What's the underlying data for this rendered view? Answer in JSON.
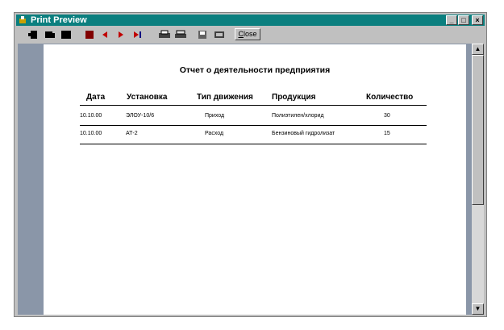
{
  "window": {
    "title": "Print Preview"
  },
  "toolbar": {
    "close_label": "Close",
    "close_access_key": "C",
    "close_rest": "lose"
  },
  "report": {
    "title": "Отчет о деятельности предприятия",
    "columns": [
      "Дата",
      "Установка",
      "Тип движения",
      "Продукция",
      "Количество"
    ],
    "rows": [
      [
        "10.10.00",
        "ЭЛОУ-10/6",
        "Приход",
        "Полиэтилен/хлорид",
        "30"
      ],
      [
        "10.10.00",
        "АТ-2",
        "Расход",
        "Бензиновый гидролизат",
        "15"
      ]
    ]
  }
}
